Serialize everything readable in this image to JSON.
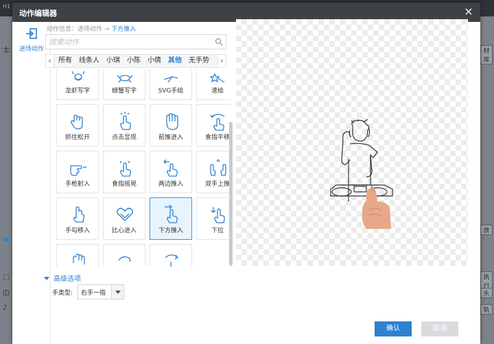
{
  "background": {
    "top_left_text": "H1",
    "left_glyphs": [
      "士",
      "▣",
      "⬚",
      "◫",
      "♪"
    ],
    "right_items": [
      "材库",
      "放",
      "执行",
      "头",
      "轨"
    ]
  },
  "dialog": {
    "title": "动作编辑器",
    "close_label": "×"
  },
  "sidenav": {
    "items": [
      {
        "label": "进场动作",
        "icon": "enter-icon"
      }
    ]
  },
  "breadcrumb": {
    "prefix": "动作信息：进场动作",
    "separator": " → ",
    "current": "下方推入"
  },
  "search": {
    "placeholder": "搜索动作",
    "value": ""
  },
  "tabs": {
    "prev": "‹",
    "next": "›",
    "items": [
      "所有",
      "线条人",
      "小琪",
      "小陈",
      "小倩",
      "其他",
      "无手势"
    ],
    "active": "其他"
  },
  "actions": [
    {
      "label": "龙虾写字",
      "icon": "lobster-icon"
    },
    {
      "label": "螃蟹写字",
      "icon": "crab-icon"
    },
    {
      "label": "SVG手绘",
      "icon": "pen-hand-icon"
    },
    {
      "label": "速绘",
      "icon": "star-wand-icon"
    },
    {
      "label": "抓住松开",
      "icon": "grab-hand-icon"
    },
    {
      "label": "点击显现",
      "icon": "tap-hand-icon"
    },
    {
      "label": "前推进入",
      "icon": "push-forward-hand-icon"
    },
    {
      "label": "食指平移",
      "icon": "finger-slide-icon"
    },
    {
      "label": "手枪射入",
      "icon": "pistol-hand-icon"
    },
    {
      "label": "食指摇晃",
      "icon": "finger-wave-icon"
    },
    {
      "label": "两边推入",
      "icon": "side-push-hand-icon"
    },
    {
      "label": "双手上推",
      "icon": "two-hands-up-icon"
    },
    {
      "label": "手勾移入",
      "icon": "hook-hand-icon"
    },
    {
      "label": "比心进入",
      "icon": "heart-hands-icon"
    },
    {
      "label": "下方推入",
      "icon": "push-up-hand-icon"
    },
    {
      "label": "下拉",
      "icon": "pull-down-hand-icon"
    },
    {
      "label": "",
      "icon": "palm-hand-icon"
    },
    {
      "label": "",
      "icon": "curl-hand-icon"
    },
    {
      "label": "",
      "icon": "rotate-hand-icon"
    }
  ],
  "selected_action": "下方推入",
  "advanced": {
    "label": "高级选项",
    "hand_type_label": "手类型:",
    "hand_type_value": "右手一指"
  },
  "buttons": {
    "ok": "确认",
    "cancel": "取消"
  },
  "colors": {
    "accent": "#2f80d1",
    "titlebar": "#3e4247",
    "selected_bg": "#e8f3fc"
  }
}
